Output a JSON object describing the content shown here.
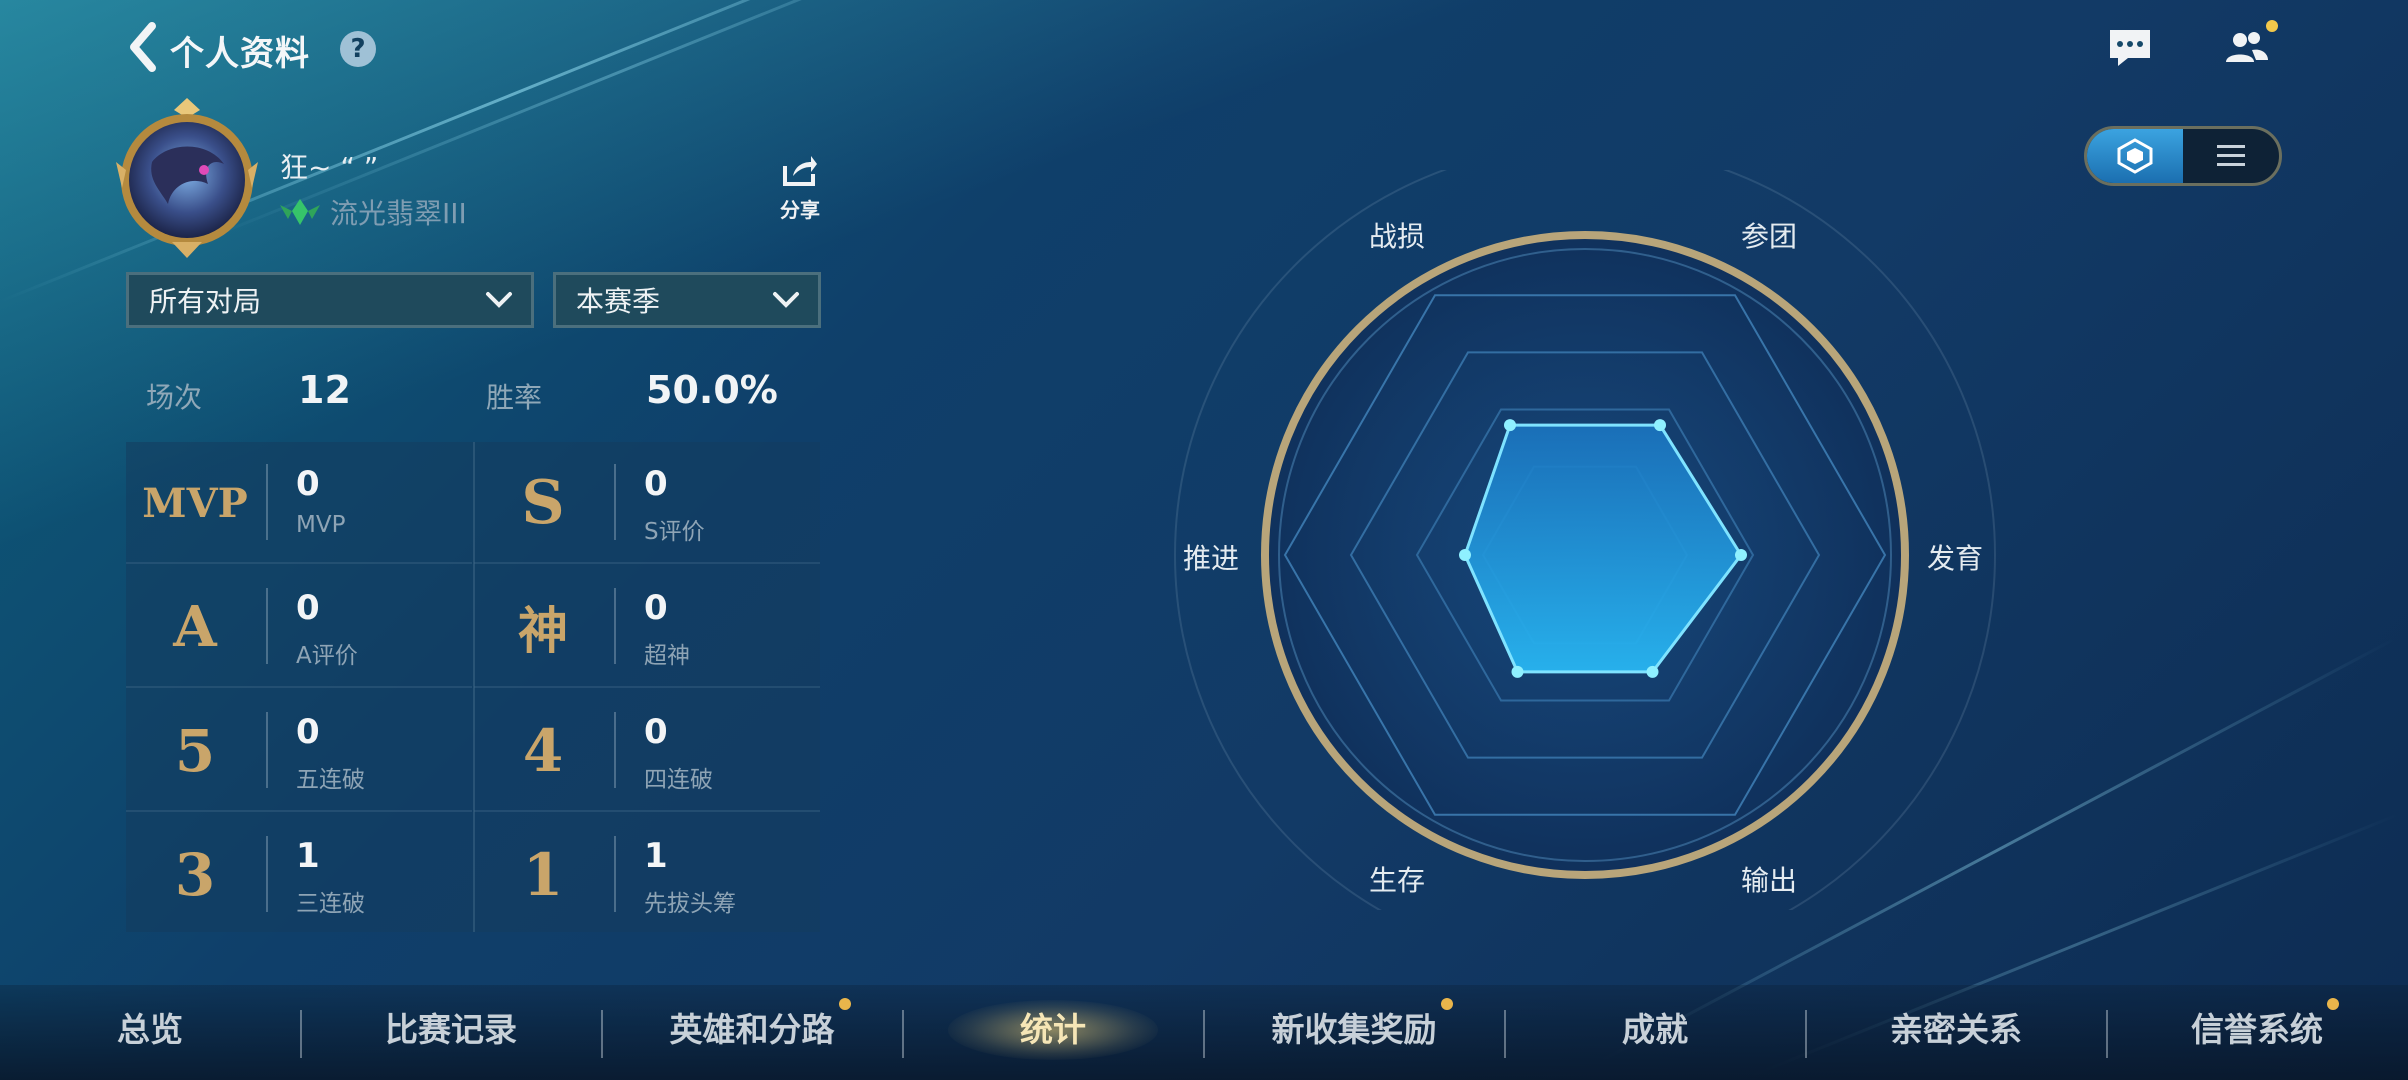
{
  "header": {
    "title": "个人资料",
    "help_glyph": "?"
  },
  "profile": {
    "username": "狂~ “ ”",
    "rank": "流光翡翠III",
    "share_label": "分享"
  },
  "filters": {
    "mode_selected": "所有对局",
    "season_selected": "本赛季"
  },
  "summary": {
    "matches_label": "场次",
    "matches_value": "12",
    "winrate_label": "胜率",
    "winrate_value": "50.0%"
  },
  "stats": [
    {
      "badge": "MVP",
      "value": "0",
      "label": "MVP"
    },
    {
      "badge": "S",
      "value": "0",
      "label": "S评价"
    },
    {
      "badge": "A",
      "value": "0",
      "label": "A评价"
    },
    {
      "badge": "神",
      "value": "0",
      "label": "超神"
    },
    {
      "badge": "5",
      "value": "0",
      "label": "五连破"
    },
    {
      "badge": "4",
      "value": "0",
      "label": "四连破"
    },
    {
      "badge": "3",
      "value": "1",
      "label": "三连破"
    },
    {
      "badge": "1",
      "value": "1",
      "label": "先拔头筹"
    }
  ],
  "radar": {
    "axes": [
      "参团",
      "发育",
      "输出",
      "生存",
      "推进",
      "战损"
    ],
    "values": [
      0.5,
      0.52,
      0.45,
      0.45,
      0.4,
      0.5
    ]
  },
  "tabs": [
    {
      "label": "总览",
      "dot": false,
      "active": false
    },
    {
      "label": "比赛记录",
      "dot": false,
      "active": false
    },
    {
      "label": "英雄和分路",
      "dot": true,
      "active": false
    },
    {
      "label": "统计",
      "dot": false,
      "active": true
    },
    {
      "label": "新收集奖励",
      "dot": true,
      "active": false
    },
    {
      "label": "成就",
      "dot": false,
      "active": false
    },
    {
      "label": "亲密关系",
      "dot": false,
      "active": false
    },
    {
      "label": "信誉系统",
      "dot": true,
      "active": false
    }
  ],
  "icons": {
    "back": "chevron-left-icon",
    "help": "help-icon",
    "chat": "chat-icon",
    "friends": "friends-icon",
    "share": "share-icon",
    "dropdown": "chevron-down-icon",
    "radar_view": "hexagon-icon",
    "list_view": "list-icon"
  },
  "colors": {
    "accent_gold": "#c9a56a",
    "radar_fill": "#1fa8e8",
    "notify": "#f2c84b"
  }
}
